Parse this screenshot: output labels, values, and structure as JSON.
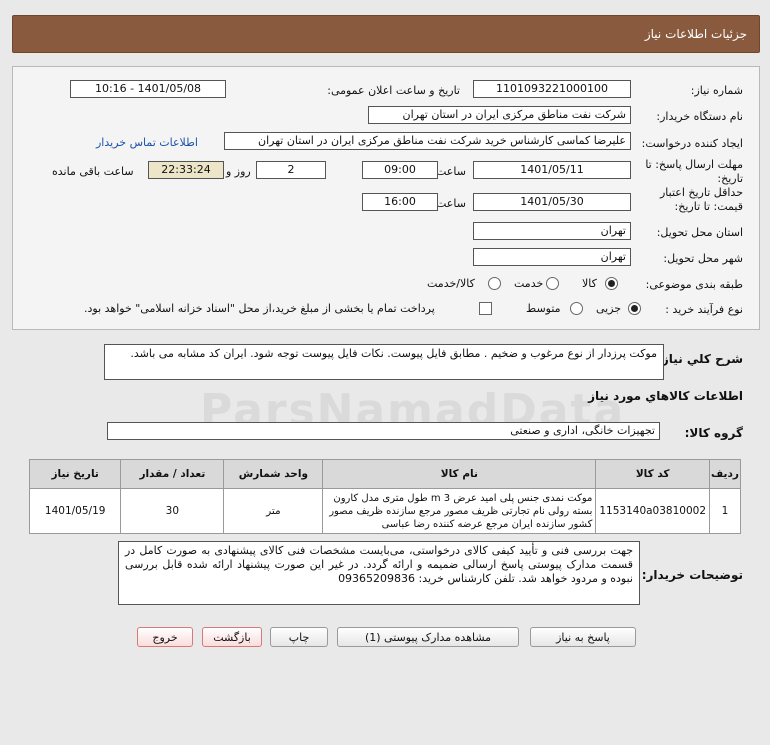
{
  "header": {
    "title": "جزئیات اطلاعات نیاز"
  },
  "fields": {
    "need_number_label": "شماره نیاز:",
    "need_number": "1101093221000100",
    "announce_label": "تاریخ و ساعت اعلان عمومی:",
    "announce_value": "1401/05/08 - 10:16",
    "buyer_org_label": "نام دستگاه خریدار:",
    "buyer_org": "شرکت نفت مناطق مرکزی ایران در استان تهران",
    "requester_label": "ایجاد کننده درخواست:",
    "requester": "علیرضا کماسی کارشناس خرید شرکت نفت مناطق مرکزی ایران در استان تهران",
    "contact_link": "اطلاعات تماس خریدار",
    "deadline_label": "مهلت ارسال پاسخ: تا تاریخ:",
    "deadline_date": "1401/05/11",
    "time_label": "ساعت",
    "deadline_time": "09:00",
    "days_value": "2",
    "days_label": "روز و",
    "remaining_time": "22:33:24",
    "remaining_label": "ساعت باقی مانده",
    "validity_label": "حداقل تاریخ اعتبار قیمت: تا تاریخ:",
    "validity_date": "1401/05/30",
    "validity_time_label": "ساعت",
    "validity_time": "16:00",
    "province_label": "استان محل تحویل:",
    "province": "تهران",
    "city_label": "شهر محل تحویل:",
    "city": "تهران",
    "category_label": "طبقه بندی موضوعی:",
    "category_options": [
      "کالا",
      "خدمت",
      "کالا/خدمت"
    ],
    "process_label": "نوع فرآیند خرید :",
    "process_options": [
      "جزیی",
      "متوسط"
    ],
    "payment_note": "پرداخت تمام یا بخشی از مبلغ خرید،از محل \"اسناد خزانه اسلامی\" خواهد بود."
  },
  "summary": {
    "label": "شرح کلي نياز:",
    "text": "موکت پرزدار از نوع مرغوب و ضخیم . مطابق فایل پیوست. نکات فایل پیوست توجه شود. ایران کد مشابه می باشد."
  },
  "goods_section": {
    "title": "اطلاعات کالاهاي مورد نياز",
    "group_label": "گروه کالا:",
    "group_value": "تجهیزات خانگی، اداری و صنعتی"
  },
  "table": {
    "headers": [
      "ردیف",
      "کد کالا",
      "نام کالا",
      "واحد شمارش",
      "تعداد / مقدار",
      "تاریخ نیاز"
    ],
    "rows": [
      {
        "row": "1",
        "code": "1153140a03810002",
        "name": "موکت نمدی جنس پلی امید عرض m 3 طول متری مدل کارون بسته رولی نام تجارتی ظریف مصور مرجع سازنده ظریف مصور کشور سازنده ایران مرجع عرضه کننده رضا عباسی",
        "unit": "متر",
        "qty": "30",
        "date": "1401/05/19"
      }
    ]
  },
  "buyer_notes": {
    "label": "توضیحات خریدار:",
    "text": "جهت بررسی فنی و تأیید کیفی کالای درخواستی، می‌بایست مشخصات فنی کالای پیشنهادی به صورت کامل در قسمت مدارک پیوستی پاسخ ارسالی ضمیمه و ارائه گردد. در غیر این صورت پیشنهاد ارائه شده قابل بررسی نبوده و مردود خواهد شد. تلفن کارشناس خرید: 09365209836"
  },
  "buttons": {
    "reply": "پاسخ به نیاز",
    "attachments": "مشاهده مدارک پیوستی (1)",
    "print": "چاپ",
    "back": "بازگشت",
    "exit": "خروج"
  },
  "colors": {
    "header_bg": "#8a5a3e",
    "link": "#1b54a8",
    "remaining_bg": "#ece5c8"
  },
  "watermark": "ParsNamadData"
}
